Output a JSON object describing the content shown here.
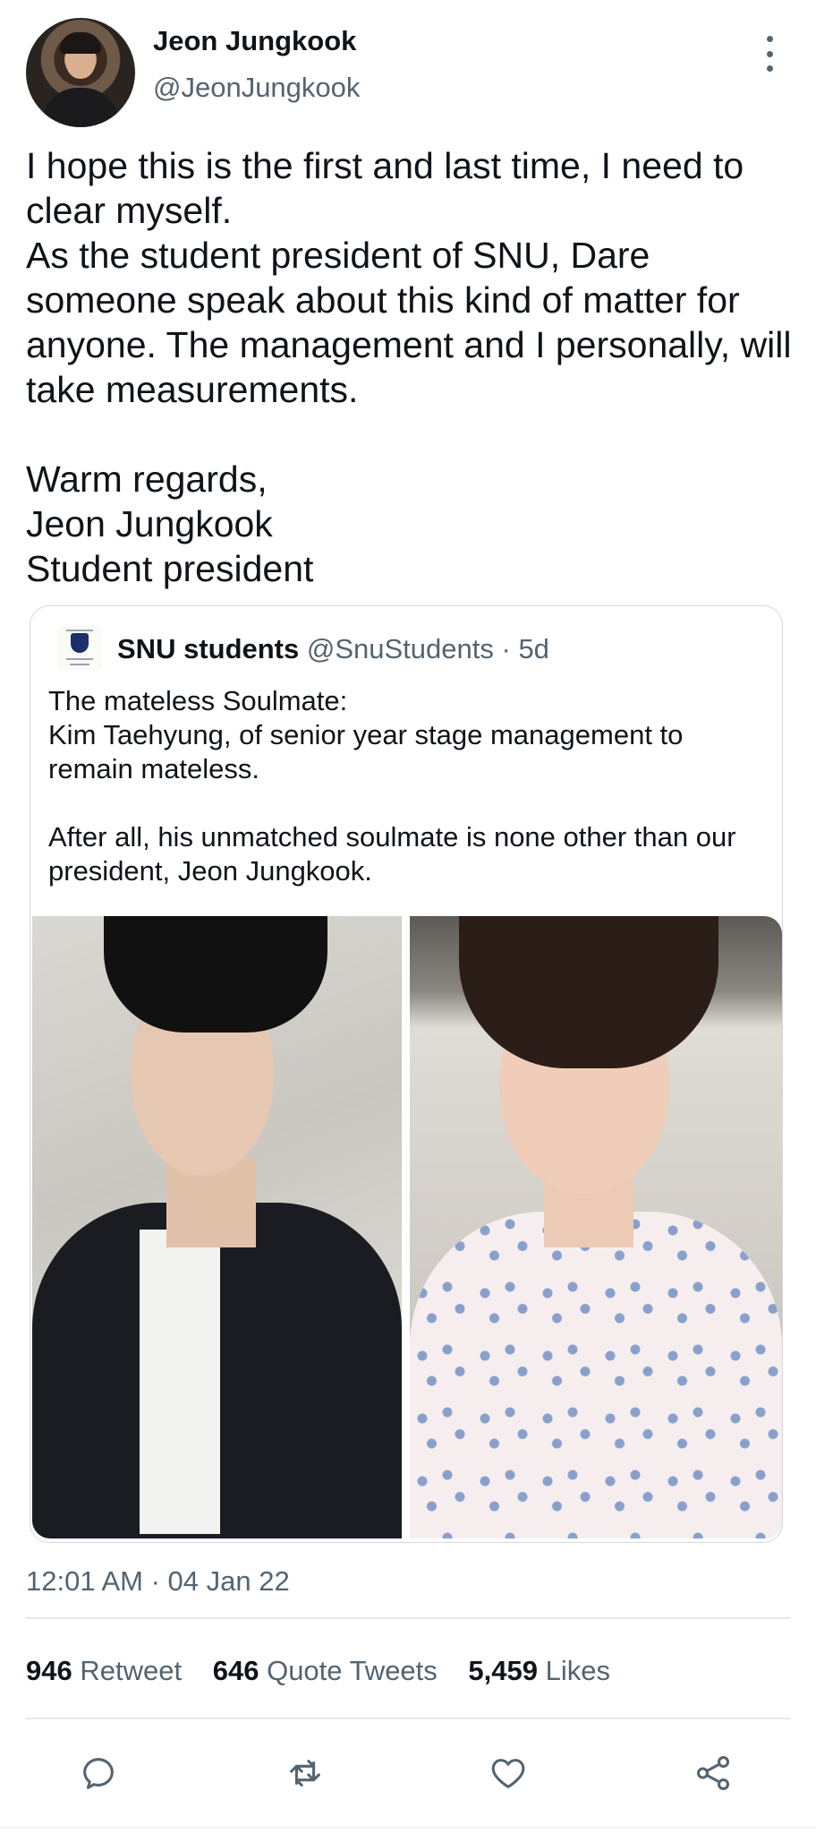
{
  "author": {
    "name": "Jeon Jungkook",
    "handle": "@JeonJungkook"
  },
  "tweet": {
    "text": "I hope this is the first and last time, I need to clear myself.\nAs the student president of SNU, Dare someone speak about this kind of matter for anyone. The management and I personally, will take measurements.\n\nWarm regards,\nJeon Jungkook\nStudent president"
  },
  "quote": {
    "name": "SNU students",
    "handle": "@SnuStudents",
    "separator": " · ",
    "time": "5d",
    "text": "The mateless Soulmate:\nKim Taehyung, of senior year stage management to remain mateless.\n\nAfter all, his unmatched soulmate is none other than our president, Jeon Jungkook."
  },
  "timestamp": "12:01 AM · 04 Jan 22",
  "stats": {
    "retweets": {
      "count": "946",
      "label": "Retweet"
    },
    "quotes": {
      "count": "646",
      "label": "Quote Tweets"
    },
    "likes": {
      "count": "5,459",
      "label": "Likes"
    }
  },
  "icons": {
    "more": "more-vertical-icon",
    "reply": "reply-icon",
    "retweet": "retweet-icon",
    "like": "heart-icon",
    "share": "share-icon"
  },
  "colors": {
    "text": "#0f1419",
    "secondary": "#536471",
    "border": "#cfd9de"
  }
}
